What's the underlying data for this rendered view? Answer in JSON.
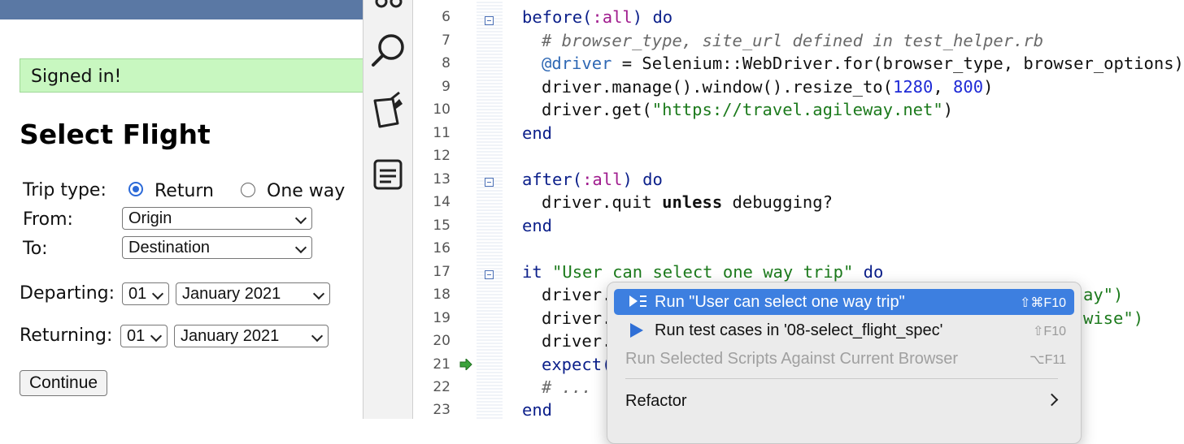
{
  "browser": {
    "flash": "Signed in!",
    "heading": "Select Flight",
    "trip_type_label": "Trip type:",
    "return_label": "Return",
    "oneway_label": "One way",
    "from_label": "From:",
    "from_value": "Origin",
    "to_label": "To:",
    "to_value": "Destination",
    "departing_label": "Departing:",
    "departing_day": "01",
    "departing_month": "January 2021",
    "returning_label": "Returning:",
    "returning_day": "01",
    "returning_month": "January 2021",
    "continue_label": "Continue"
  },
  "toolbar": {
    "icons": [
      "share-icon",
      "search-icon",
      "pin-note-icon",
      "list-icon"
    ]
  },
  "editor": {
    "line_numbers": [
      "6",
      "7",
      "8",
      "9",
      "10",
      "11",
      "12",
      "13",
      "14",
      "15",
      "16",
      "17",
      "18",
      "19",
      "20",
      "21",
      "22",
      "23"
    ],
    "lines": {
      "l6_kw": "before(",
      "l6_sym": ":all",
      "l6_kw2": ") do",
      "l7": "# browser_type, site_url defined in test_helper.rb",
      "l8_ivar": "@driver",
      "l8_rest": " = Selenium::WebDriver.for(browser_type, browser_options)",
      "l9_a": "driver.manage().window().resize_to(",
      "l9_n1": "1280",
      "l9_c": ", ",
      "l9_n2": "800",
      "l9_e": ")",
      "l10_a": "driver.get(",
      "l10_s": "\"https://travel.agileway.net\"",
      "l10_e": ")",
      "l11": "end",
      "l13_kw": "after(",
      "l13_sym": ":all",
      "l13_kw2": ") do",
      "l14_a": "driver.quit ",
      "l14_b": "unless",
      "l14_c": " debugging?",
      "l15": "end",
      "l17_kw": "it ",
      "l17_s": "\"User can select one way trip\"",
      "l17_kw2": " do",
      "l18": "driver.",
      "l18_tail": "ay\")",
      "l19": "driver.",
      "l19_tail": "wise\")",
      "l20": "driver.",
      "l21": "expect(",
      "l22": "# ...",
      "l23": "end"
    }
  },
  "menu": {
    "items": [
      {
        "label": "Run \"User can select one way trip\"",
        "shortcut": "⇧⌘F10"
      },
      {
        "label": "Run test cases in '08-select_flight_spec'",
        "shortcut": "⇧F10"
      },
      {
        "label": "Run Selected Scripts Against Current Browser",
        "shortcut": "⌥F11"
      },
      {
        "label": "Refactor",
        "shortcut": ""
      }
    ]
  },
  "colors": {
    "highlight": "#3d7fe0",
    "flash_bg": "#c8f7c0",
    "keyword": "#0b1f8a",
    "string": "#1c7a1c",
    "symbol": "#a01c8e"
  }
}
